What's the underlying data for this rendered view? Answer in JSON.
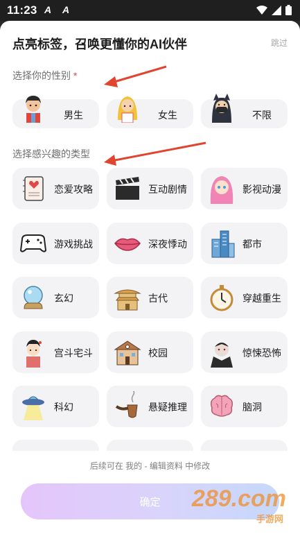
{
  "status_bar": {
    "time": "11:23",
    "app_icons": [
      "A",
      "A"
    ]
  },
  "header": {
    "title": "点亮标签，召唤更懂你的AI伙伴",
    "skip_label": "跳过"
  },
  "gender_section": {
    "title": "选择你的性别",
    "required_mark": "*",
    "options": [
      {
        "label": "男生",
        "icon": "boy-avatar-icon"
      },
      {
        "label": "女生",
        "icon": "girl-avatar-icon"
      },
      {
        "label": "不限",
        "icon": "masked-cat-avatar-icon"
      }
    ]
  },
  "interest_section": {
    "title": "选择感兴趣的类型",
    "options": [
      {
        "label": "恋爱攻略",
        "icon": "love-diary-icon"
      },
      {
        "label": "互动剧情",
        "icon": "clapperboard-icon"
      },
      {
        "label": "影视动漫",
        "icon": "anime-girl-icon"
      },
      {
        "label": "游戏挑战",
        "icon": "gamepad-icon"
      },
      {
        "label": "深夜悸动",
        "icon": "lips-icon"
      },
      {
        "label": "都市",
        "icon": "city-buildings-icon"
      },
      {
        "label": "玄幻",
        "icon": "crystal-ball-icon"
      },
      {
        "label": "古代",
        "icon": "pagoda-icon"
      },
      {
        "label": "穿越重生",
        "icon": "stopwatch-icon"
      },
      {
        "label": "宫斗宅斗",
        "icon": "palace-lady-icon"
      },
      {
        "label": "校园",
        "icon": "school-building-icon"
      },
      {
        "label": "惊悚恐怖",
        "icon": "vampire-icon"
      },
      {
        "label": "科幻",
        "icon": "ufo-icon"
      },
      {
        "label": "悬疑推理",
        "icon": "detective-pipe-icon"
      },
      {
        "label": "脑洞",
        "icon": "brain-icon"
      }
    ]
  },
  "footer": {
    "hint": "后续可在 我的 - 编辑资料 中修改",
    "confirm_label": "确定"
  },
  "watermark": {
    "text": "289.com",
    "sub": "手游网"
  },
  "colors": {
    "card_bg": "#f3f3f5",
    "required": "#e34848",
    "annotation_arrow": "#e0462f",
    "confirm_gradient": [
      "#e4c5fb",
      "#c5d8fb"
    ]
  }
}
